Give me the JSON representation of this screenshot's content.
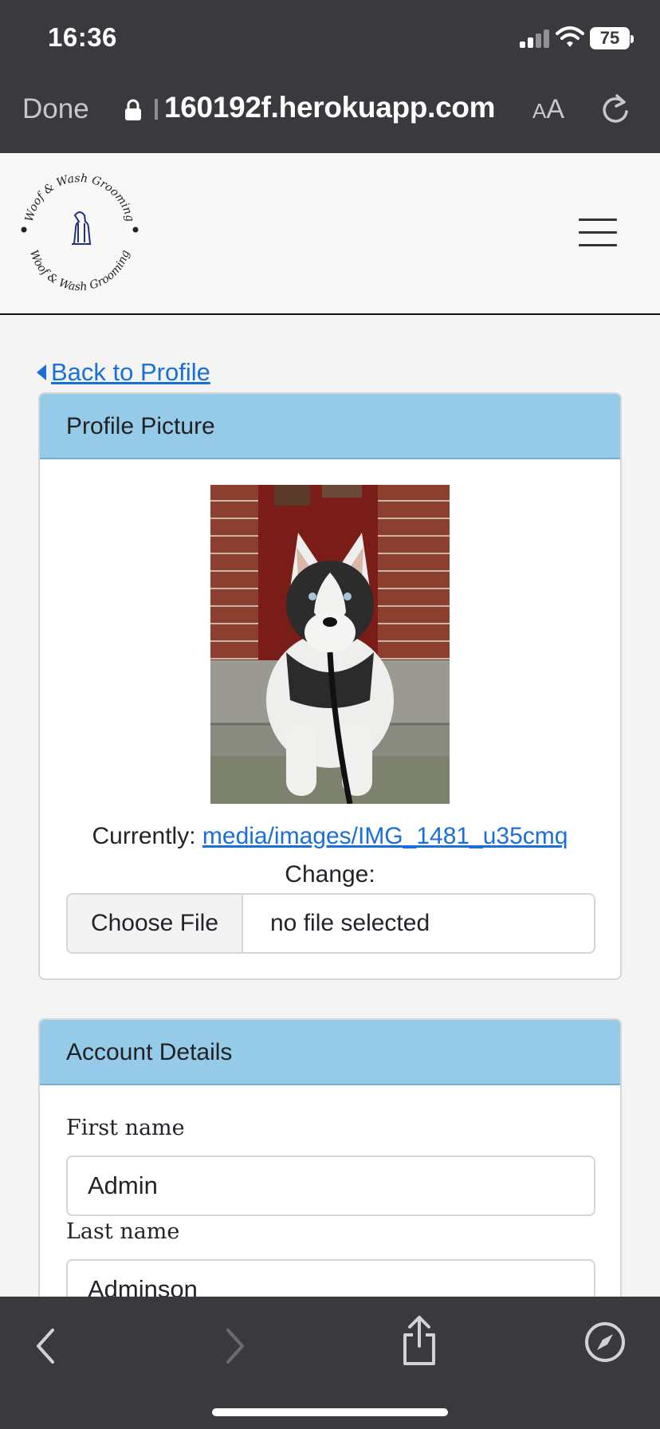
{
  "status_bar": {
    "time": "16:36",
    "battery": "75"
  },
  "browser": {
    "done_label": "Done",
    "url": "160192f.herokuapp.com",
    "aa_small": "A",
    "aa_large": "A"
  },
  "site": {
    "logo_text_top": "Woof & Wash Grooming",
    "logo_text_bottom": "Woof & Wash Grooming"
  },
  "back_link": "Back to Profile",
  "profile_picture": {
    "header": "Profile Picture",
    "currently_label": "Currently:",
    "currently_link": "media/images/IMG_1481_u35cmq",
    "change_label": "Change:",
    "choose_file_label": "Choose File",
    "file_status": "no file selected"
  },
  "account_details": {
    "header": "Account Details",
    "first_name_label": "First name",
    "first_name_value": "Admin",
    "last_name_label": "Last name",
    "last_name_value": "Adminson"
  },
  "colors": {
    "card_header": "#95cbe8",
    "link": "#1a6fd8",
    "chrome": "#3a3a3e"
  }
}
